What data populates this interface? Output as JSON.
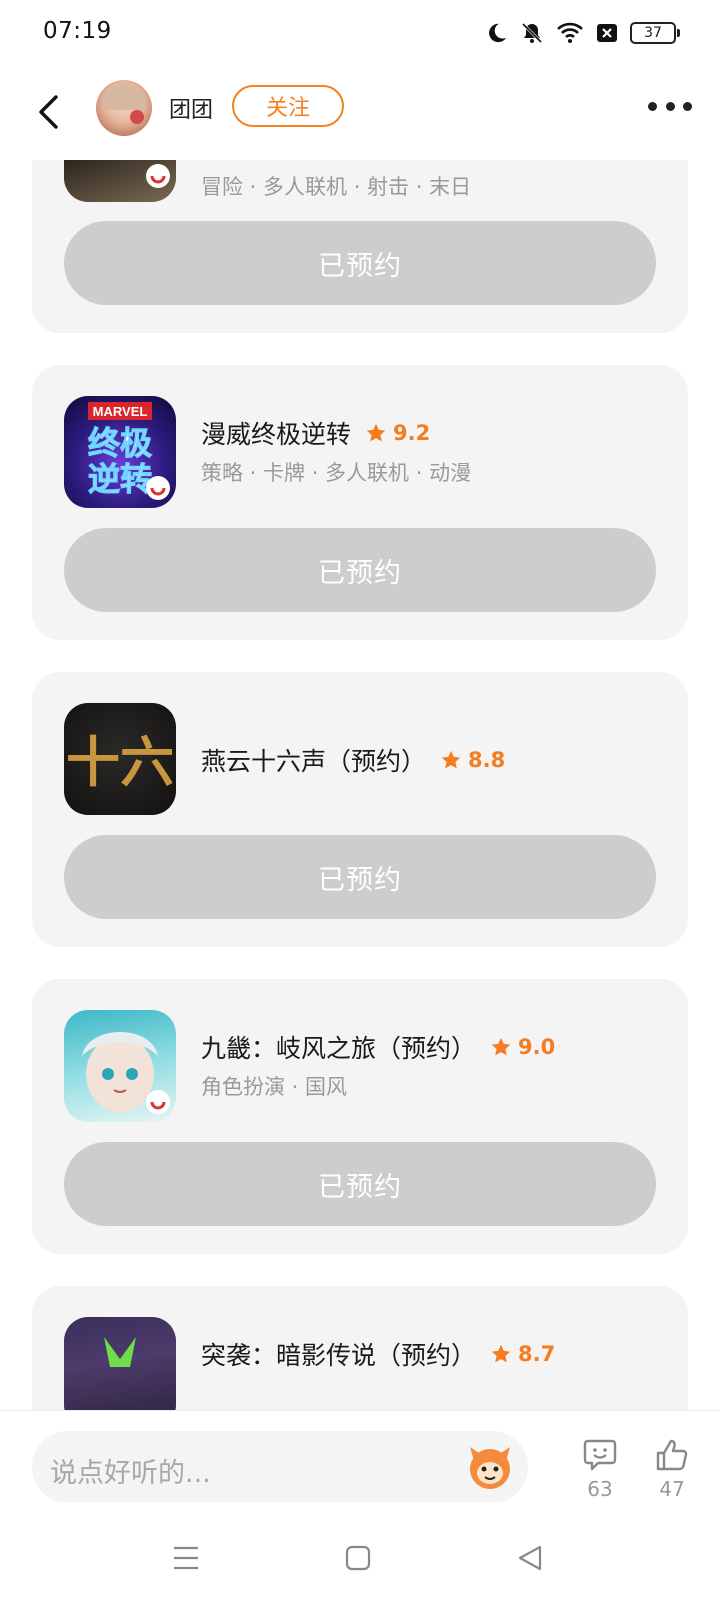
{
  "status_bar": {
    "time": "07:19",
    "battery": "37"
  },
  "header": {
    "username": "团团",
    "follow_label": "关注"
  },
  "cards": [
    {
      "name": "",
      "rating": "",
      "tags": "冒险 · 多人联机 · 射击 · 末日",
      "button": "已预约"
    },
    {
      "name": "漫威终极逆转",
      "rating": "9.2",
      "tags": "策略 · 卡牌 · 多人联机 · 动漫",
      "button": "已预约"
    },
    {
      "name": "燕云十六声（预约）",
      "rating": "8.8",
      "tags": "",
      "button": "已预约"
    },
    {
      "name": "九畿：岐风之旅（预约）",
      "rating": "9.0",
      "tags": "角色扮演 · 国风",
      "button": "已预约"
    },
    {
      "name": "突袭：暗影传说（预约）",
      "rating": "8.7",
      "tags": "",
      "button": ""
    }
  ],
  "icon_art": {
    "marvel_top": "MARVEL",
    "marvel_line1": "终极",
    "marvel_line2": "逆转",
    "yanyun": "十六"
  },
  "bottom_bar": {
    "placeholder": "说点好听的...",
    "comment_count": "63",
    "like_count": "47"
  },
  "colors": {
    "accent": "#f58220",
    "rating": "#f57c1f",
    "reserved_button": "#cdcdcd",
    "card_bg": "#f4f4f4"
  },
  "icons": [
    "moon-icon",
    "bell-off-icon",
    "wifi-icon",
    "sim-x-icon",
    "battery-icon",
    "back-icon",
    "more-icon",
    "star-icon",
    "comment-icon",
    "thumbs-up-icon",
    "menu-icon",
    "home-icon",
    "back-triangle-icon"
  ]
}
